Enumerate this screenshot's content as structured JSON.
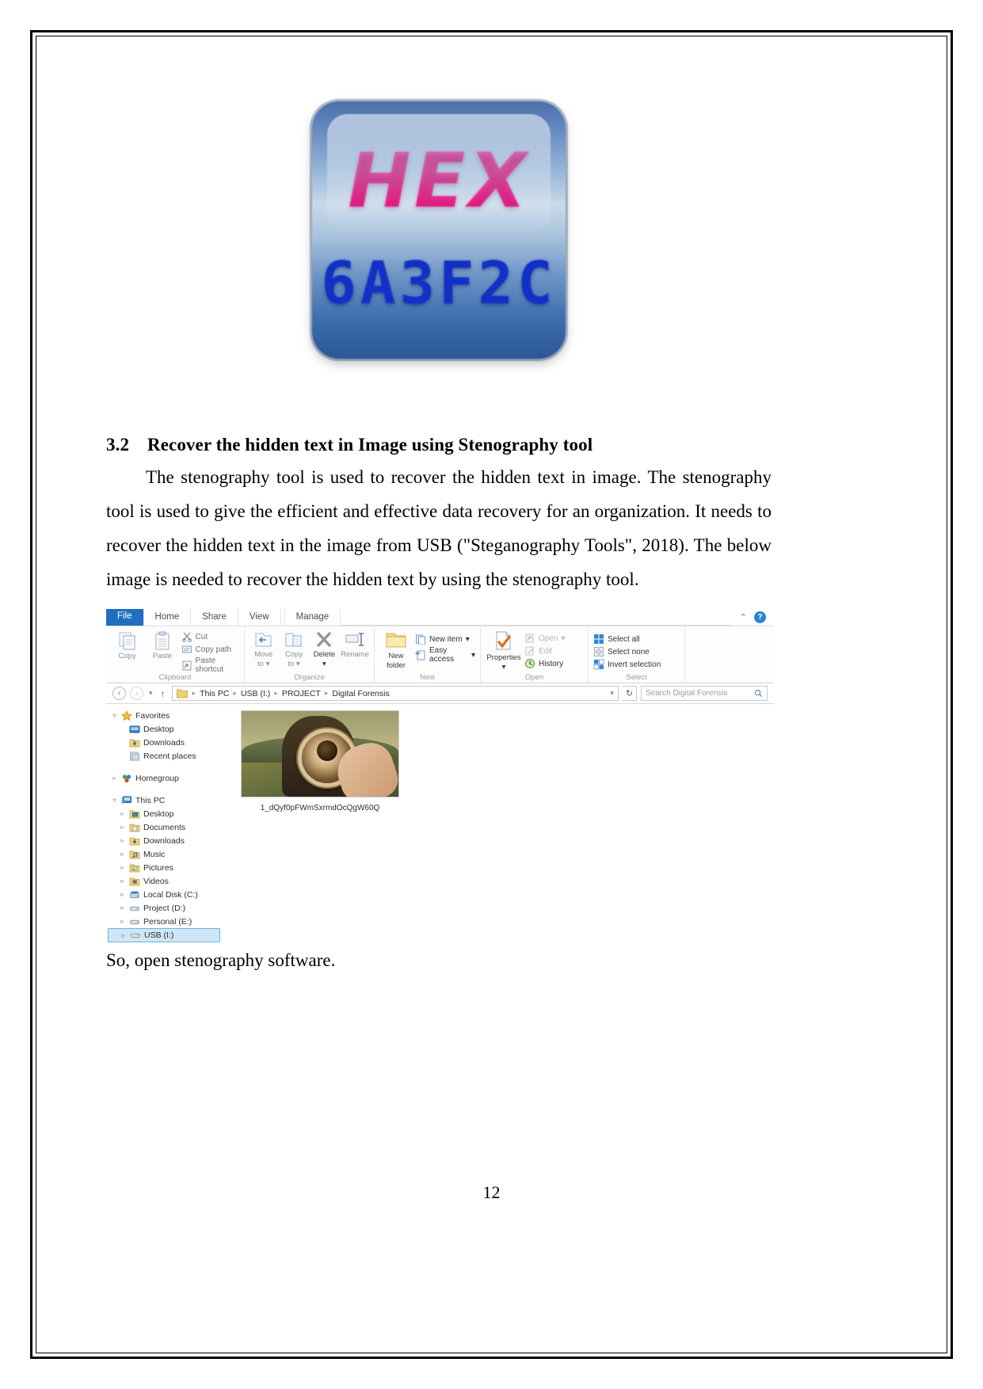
{
  "page": {
    "number": "12"
  },
  "logo": {
    "name": "hex-logo",
    "word": "HEX",
    "code": "6A3F2C"
  },
  "section": {
    "number": "3.2",
    "title": "Recover the hidden text in Image using Stenography tool",
    "paragraph": "The stenography tool is used to recover the hidden text in image. The stenography tool is used to give the efficient and effective data recovery for an organization. It needs to recover the hidden text in the image from USB (\"Steganography Tools\", 2018). The below image is needed to recover the hidden text by using the stenography tool.",
    "closing_line": "So, open stenography software."
  },
  "explorer": {
    "tabs": {
      "file": "File",
      "home": "Home",
      "share": "Share",
      "view": "View",
      "manage": "Manage"
    },
    "help": {
      "collapse_glyph": "⌃",
      "help_glyph": "?"
    },
    "groups": [
      {
        "title": "Clipboard",
        "big_buttons": [
          {
            "label": "Copy",
            "icon": "copy-icon"
          },
          {
            "label": "Paste",
            "icon": "paste-icon"
          }
        ],
        "small_items": [
          {
            "label": "Cut",
            "icon": "scissors-icon"
          },
          {
            "label": "Copy path",
            "icon": "copy-path-icon"
          },
          {
            "label": "Paste shortcut",
            "icon": "paste-shortcut-icon"
          }
        ]
      },
      {
        "title": "Organize",
        "big_buttons": [
          {
            "label": "Move to",
            "icon": "move-to-icon"
          },
          {
            "label": "Copy to",
            "icon": "copy-to-icon"
          },
          {
            "label": "Delete",
            "icon": "delete-icon"
          },
          {
            "label": "Rename",
            "icon": "rename-icon"
          }
        ],
        "small_items": []
      },
      {
        "title": "New",
        "big_buttons": [
          {
            "label": "New folder",
            "icon": "new-folder-icon"
          }
        ],
        "small_items": [
          {
            "label": "New item",
            "icon": "new-item-icon"
          },
          {
            "label": "Easy access",
            "icon": "easy-access-icon"
          }
        ]
      },
      {
        "title": "Open",
        "big_buttons": [
          {
            "label": "Properties",
            "icon": "properties-icon"
          }
        ],
        "small_items": [
          {
            "label": "Open",
            "icon": "open-icon"
          },
          {
            "label": "Edit",
            "icon": "edit-icon"
          },
          {
            "label": "History",
            "icon": "history-icon"
          }
        ]
      },
      {
        "title": "Select",
        "big_buttons": [],
        "small_items": [
          {
            "label": "Select all",
            "icon": "select-all-icon"
          },
          {
            "label": "Select none",
            "icon": "select-none-icon"
          },
          {
            "label": "Invert selection",
            "icon": "invert-selection-icon"
          }
        ]
      }
    ],
    "labels": {
      "move_to_line1": "Move",
      "move_to_line2": "to",
      "copy_to_line1": "Copy",
      "copy_to_line2": "to",
      "new_folder_line1": "New",
      "new_folder_line2": "folder",
      "delete": "Delete",
      "rename": "Rename",
      "properties": "Properties",
      "copy": "Copy",
      "paste": "Paste"
    },
    "address_bar": {
      "back_glyph": "‹",
      "forward_glyph": "›",
      "recent_glyph": "▾",
      "up_glyph": "↑",
      "refresh_glyph": "↻",
      "dropdown_glyph": "▾",
      "breadcrumbs": [
        "This PC",
        "USB (I:)",
        "PROJECT",
        "Digital Forensis"
      ],
      "separator": "▸"
    },
    "search": {
      "placeholder": "Search Digital Forensis",
      "icon": "search-icon"
    },
    "nav_tree": [
      {
        "label": "Favorites",
        "indent": 0,
        "expander": "▿",
        "icon": "star-icon",
        "selected": false
      },
      {
        "label": "Desktop",
        "indent": 1,
        "expander": "",
        "icon": "desktop-icon",
        "selected": false
      },
      {
        "label": "Downloads",
        "indent": 1,
        "expander": "",
        "icon": "downloads-icon",
        "selected": false
      },
      {
        "label": "Recent places",
        "indent": 1,
        "expander": "",
        "icon": "recent-places-icon",
        "selected": false
      },
      {
        "label": "Homegroup",
        "indent": 0,
        "expander": "▹",
        "icon": "homegroup-icon",
        "selected": false
      },
      {
        "label": "This PC",
        "indent": 0,
        "expander": "▿",
        "icon": "this-pc-icon",
        "selected": false
      },
      {
        "label": "Desktop",
        "indent": 1,
        "expander": "▹",
        "icon": "desktop-folder-icon",
        "selected": false
      },
      {
        "label": "Documents",
        "indent": 1,
        "expander": "▹",
        "icon": "documents-icon",
        "selected": false
      },
      {
        "label": "Downloads",
        "indent": 1,
        "expander": "▹",
        "icon": "downloads-icon",
        "selected": false
      },
      {
        "label": "Music",
        "indent": 1,
        "expander": "▹",
        "icon": "music-icon",
        "selected": false
      },
      {
        "label": "Pictures",
        "indent": 1,
        "expander": "▹",
        "icon": "pictures-icon",
        "selected": false
      },
      {
        "label": "Videos",
        "indent": 1,
        "expander": "▹",
        "icon": "videos-icon",
        "selected": false
      },
      {
        "label": "Local Disk (C:)",
        "indent": 1,
        "expander": "▹",
        "icon": "local-disk-icon",
        "selected": false
      },
      {
        "label": "Project (D:)",
        "indent": 1,
        "expander": "▹",
        "icon": "drive-icon",
        "selected": false
      },
      {
        "label": "Personal (E:)",
        "indent": 1,
        "expander": "▹",
        "icon": "drive-icon",
        "selected": false
      },
      {
        "label": "USB (I:)",
        "indent": 1,
        "expander": "▹",
        "icon": "usb-drive-icon",
        "selected": true
      }
    ],
    "files": [
      {
        "name": "1_dQyf0pFWmSxrmdOcQgW60Q",
        "thumbnail": "mona-lisa-magnifier-thumbnail"
      }
    ]
  },
  "colors": {
    "file_tab_blue": "#1e6fc1",
    "selection_blue": "#cfe7f5",
    "selection_border": "#6cb4dd",
    "help_blue": "#2684d6",
    "hex_pink": "#ff1f8f",
    "hex_code_blue": "#1030c8"
  }
}
